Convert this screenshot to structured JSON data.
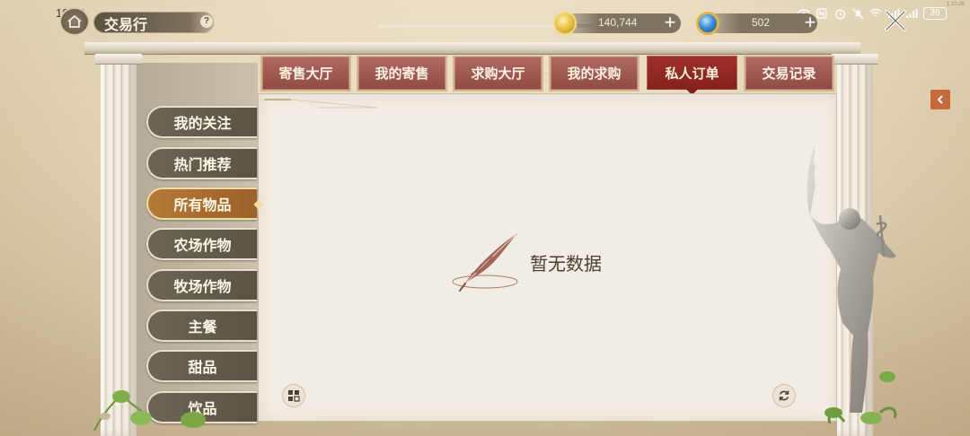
{
  "status_bar": {
    "time": "10:53",
    "battery": "36",
    "corner_code": "1.10.29"
  },
  "header": {
    "title": "交易行",
    "help_glyph": "?",
    "progress_fraction": 0.93,
    "gold_value": "140,744",
    "gem_value": "502",
    "plus_glyph": "+"
  },
  "tabs": [
    {
      "label": "寄售大厅",
      "active": false
    },
    {
      "label": "我的寄售",
      "active": false
    },
    {
      "label": "求购大厅",
      "active": false
    },
    {
      "label": "我的求购",
      "active": false
    },
    {
      "label": "私人订单",
      "active": true
    },
    {
      "label": "交易记录",
      "active": false
    }
  ],
  "categories": [
    {
      "label": "我的关注",
      "active": false
    },
    {
      "label": "热门推荐",
      "active": false
    },
    {
      "label": "所有物品",
      "active": true
    },
    {
      "label": "农场作物",
      "active": false
    },
    {
      "label": "牧场作物",
      "active": false
    },
    {
      "label": "主餐",
      "active": false
    },
    {
      "label": "甜品",
      "active": false
    },
    {
      "label": "饮品",
      "active": false
    }
  ],
  "content": {
    "empty_text": "暂无数据"
  },
  "icons": {
    "home": "home-icon",
    "help": "help-icon",
    "gold": "gold-coin-icon",
    "gem": "gem-icon",
    "close": "close-icon",
    "collapse": "chevron-left-icon",
    "layout": "grid-layout-icon",
    "refresh": "refresh-icon",
    "empty": "quill-pen-icon"
  },
  "colors": {
    "tab": "#9c554f",
    "tab_active": "#8f2621",
    "category": "#625a4c",
    "category_active": "#a96d30",
    "panel": "#f2ede4",
    "collapse": "#c66a3c"
  }
}
